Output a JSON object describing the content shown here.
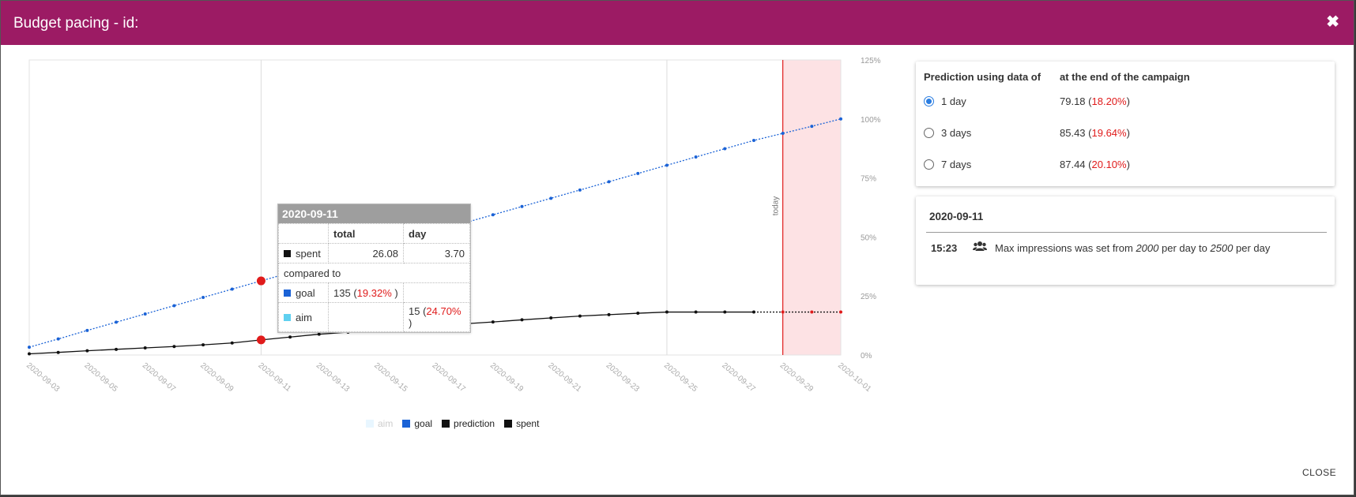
{
  "modal": {
    "title": "Budget pacing - id:",
    "close_label": "CLOSE"
  },
  "chart_data": {
    "type": "line",
    "x": [
      "2020-09-03",
      "2020-09-04",
      "2020-09-05",
      "2020-09-06",
      "2020-09-07",
      "2020-09-08",
      "2020-09-09",
      "2020-09-10",
      "2020-09-11",
      "2020-09-12",
      "2020-09-13",
      "2020-09-14",
      "2020-09-15",
      "2020-09-16",
      "2020-09-17",
      "2020-09-18",
      "2020-09-19",
      "2020-09-20",
      "2020-09-21",
      "2020-09-22",
      "2020-09-23",
      "2020-09-24",
      "2020-09-25",
      "2020-09-26",
      "2020-09-27",
      "2020-09-28",
      "2020-09-29",
      "2020-09-30",
      "2020-10-01"
    ],
    "x_tick_labels": [
      "2020-09-03",
      "2020-09-05",
      "2020-09-07",
      "2020-09-09",
      "2020-09-11",
      "2020-09-13",
      "2020-09-15",
      "2020-09-17",
      "2020-09-19",
      "2020-09-21",
      "2020-09-23",
      "2020-09-25",
      "2020-09-27",
      "2020-09-29",
      "2020-10-01"
    ],
    "y_tick_labels": [
      "0%",
      "25%",
      "50%",
      "75%",
      "100%",
      "125%"
    ],
    "ylim": [
      0,
      125
    ],
    "today_label": "today",
    "today_index": 26,
    "highlight_index": 8,
    "series": [
      {
        "name": "aim",
        "color": "#bfe9ff",
        "values": []
      },
      {
        "name": "goal",
        "color": "#1a62d6",
        "values": [
          3.3,
          6.8,
          10.4,
          13.9,
          17.4,
          20.9,
          24.4,
          27.9,
          31.4,
          34.9,
          38.4,
          41.9,
          45.4,
          48.9,
          52.4,
          55.9,
          59.4,
          62.9,
          66.4,
          69.9,
          73.4,
          76.9,
          80.4,
          83.9,
          87.4,
          90.9,
          93.9,
          96.9,
          100
        ]
      },
      {
        "name": "prediction",
        "color": "#111111",
        "values": [
          null,
          null,
          null,
          null,
          null,
          null,
          null,
          null,
          null,
          null,
          null,
          null,
          null,
          null,
          null,
          null,
          null,
          null,
          null,
          null,
          null,
          null,
          null,
          null,
          null,
          18.2,
          18.2,
          18.2,
          18.2
        ]
      },
      {
        "name": "spent",
        "color": "#111111",
        "values": [
          0.5,
          1.1,
          1.8,
          2.4,
          3.0,
          3.6,
          4.3,
          5.1,
          6.4,
          7.6,
          8.8,
          9.7,
          10.6,
          11.5,
          12.4,
          13.2,
          14.0,
          14.9,
          15.7,
          16.5,
          17.1,
          17.7,
          18.2,
          18.2,
          18.2,
          18.2
        ]
      }
    ]
  },
  "tooltip": {
    "date": "2020-09-11",
    "col_total": "total",
    "col_day": "day",
    "spent_label": "spent",
    "spent_total": "26.08",
    "spent_day": "3.70",
    "compared_to": "compared to",
    "goal_label": "goal",
    "goal_total": "135",
    "goal_pct": "19.32%",
    "aim_label": "aim",
    "aim_day": "15",
    "aim_pct": "24.70%"
  },
  "prediction": {
    "header_left": "Prediction using data of",
    "header_right": "at the end of the campaign",
    "options": [
      {
        "label": "1 day",
        "value": "79.18",
        "pct": "18.20%",
        "selected": true
      },
      {
        "label": "3 days",
        "value": "85.43",
        "pct": "19.64%",
        "selected": false
      },
      {
        "label": "7 days",
        "value": "87.44",
        "pct": "20.10%",
        "selected": false
      }
    ]
  },
  "log": {
    "date": "2020-09-11",
    "time": "15:23",
    "msg_prefix": "Max impressions was set from",
    "from_value": "2000",
    "msg_mid": "per day to",
    "to_value": "2500",
    "msg_suffix": "per day"
  },
  "colors": {
    "header": "#9c1b64",
    "accent_red": "#e01b1b",
    "goal_blue": "#1a62d6",
    "today_band": "#fde2e4"
  }
}
